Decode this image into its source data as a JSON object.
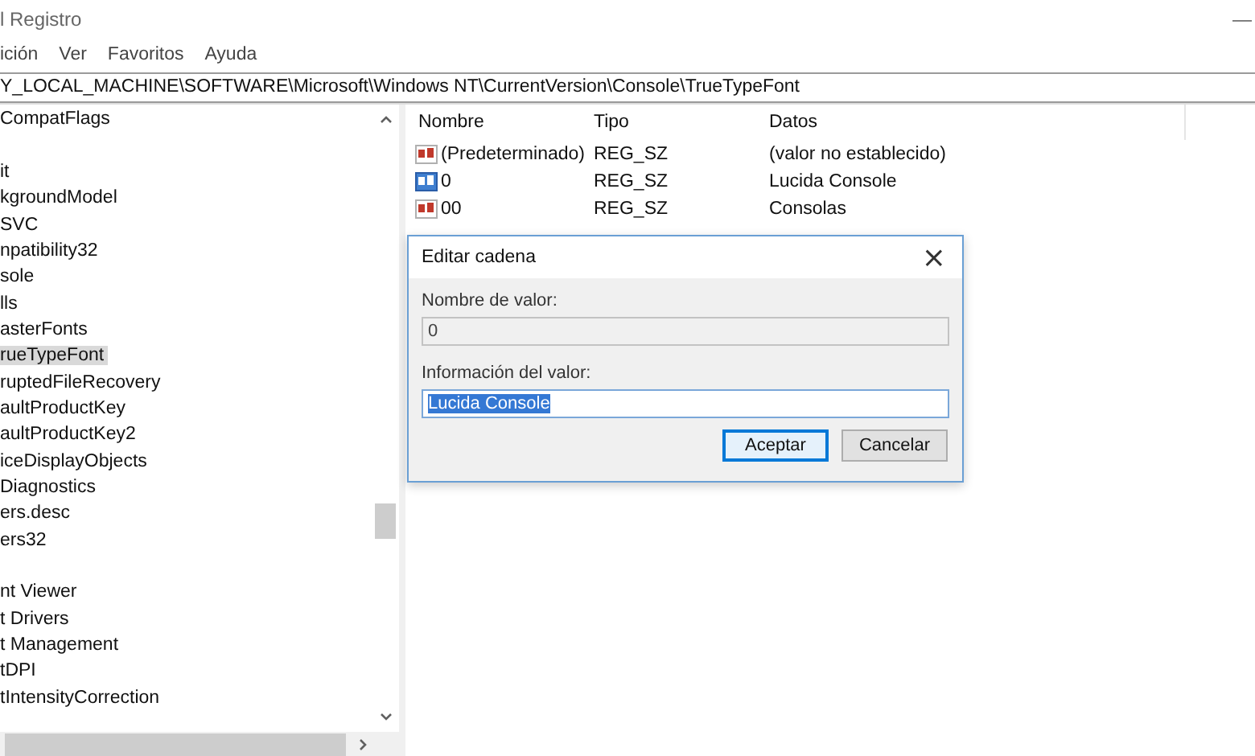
{
  "window": {
    "title": "l Registro",
    "minimize": "—"
  },
  "menu": [
    "ición",
    "Ver",
    "Favoritos",
    "Ayuda"
  ],
  "address": "Y_LOCAL_MACHINE\\SOFTWARE\\Microsoft\\Windows NT\\CurrentVersion\\Console\\TrueTypeFont",
  "tree": {
    "items": [
      {
        "kind": "key",
        "label": "CompatFlags",
        "selected": false
      },
      {
        "kind": "blank"
      },
      {
        "kind": "key",
        "label": "it",
        "selected": false
      },
      {
        "kind": "key",
        "label": "kgroundModel",
        "selected": false
      },
      {
        "kind": "key",
        "label": "SVC",
        "selected": false
      },
      {
        "kind": "key",
        "label": "npatibility32",
        "selected": false
      },
      {
        "kind": "key",
        "label": "sole",
        "selected": false
      },
      {
        "kind": "key",
        "label": "lls",
        "selected": false
      },
      {
        "kind": "key",
        "label": "asterFonts",
        "selected": false
      },
      {
        "kind": "key",
        "label": "rueTypeFont",
        "selected": true
      },
      {
        "kind": "key",
        "label": "ruptedFileRecovery",
        "selected": false
      },
      {
        "kind": "key",
        "label": "aultProductKey",
        "selected": false
      },
      {
        "kind": "key",
        "label": "aultProductKey2",
        "selected": false
      },
      {
        "kind": "key",
        "label": "iceDisplayObjects",
        "selected": false
      },
      {
        "kind": "key",
        "label": "Diagnostics",
        "selected": false
      },
      {
        "kind": "key",
        "label": "ers.desc",
        "selected": false
      },
      {
        "kind": "key",
        "label": "ers32",
        "selected": false
      },
      {
        "kind": "blank"
      },
      {
        "kind": "key",
        "label": "nt Viewer",
        "selected": false
      },
      {
        "kind": "key",
        "label": "t Drivers",
        "selected": false
      },
      {
        "kind": "key",
        "label": "t Management",
        "selected": false
      },
      {
        "kind": "key",
        "label": "tDPI",
        "selected": false
      },
      {
        "kind": "key",
        "label": "tIntensityCorrection",
        "selected": false
      }
    ]
  },
  "table": {
    "columns": [
      "Nombre",
      "Tipo",
      "Datos"
    ],
    "rows": [
      {
        "name": "(Predeterminado)",
        "type": "REG_SZ",
        "data": "(valor no establecido)",
        "selected": false
      },
      {
        "name": "0",
        "type": "REG_SZ",
        "data": "Lucida Console",
        "selected": true
      },
      {
        "name": "00",
        "type": "REG_SZ",
        "data": "Consolas",
        "selected": false
      }
    ]
  },
  "dialog": {
    "title": "Editar cadena",
    "close": "×",
    "name_label": "Nombre de valor:",
    "name_value": "0",
    "name_disabled": true,
    "value_label": "Información del valor:",
    "value": "Lucida Console",
    "value_selected": true,
    "buttons": [
      {
        "label": "Aceptar",
        "default": true
      },
      {
        "label": "Cancelar",
        "default": false
      }
    ]
  }
}
